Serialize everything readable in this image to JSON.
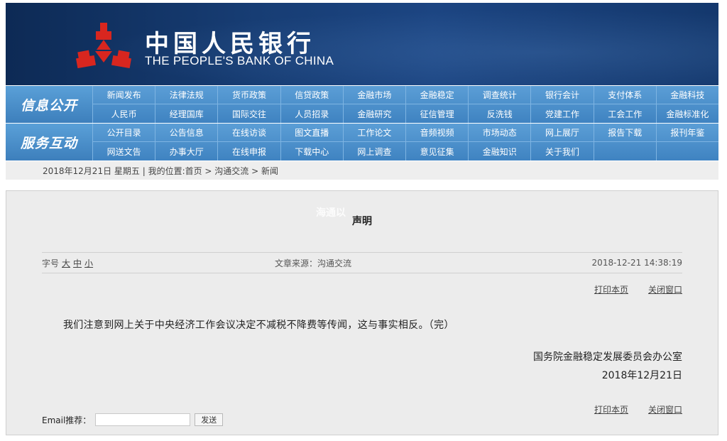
{
  "header": {
    "name_cn": "中国人民银行",
    "name_en": "THE PEOPLE'S BANK OF CHINA",
    "emblem_color": "#d8261f"
  },
  "nav": {
    "group1": {
      "label": "信息公开",
      "row1": [
        "新闻发布",
        "法律法规",
        "货币政策",
        "信贷政策",
        "金融市场",
        "金融稳定",
        "调查统计",
        "银行会计",
        "支付体系",
        "金融科技"
      ],
      "row2": [
        "人民币",
        "经理国库",
        "国际交往",
        "人员招录",
        "金融研究",
        "征信管理",
        "反洗钱",
        "党建工作",
        "工会工作",
        "金融标准化"
      ]
    },
    "group2": {
      "label": "服务互动",
      "row1": [
        "公开目录",
        "公告信息",
        "在线访谈",
        "图文直播",
        "工作论文",
        "音频视频",
        "市场动态",
        "网上展厅",
        "报告下载",
        "报刊年鉴"
      ],
      "row2": [
        "网送文告",
        "办事大厅",
        "在线申报",
        "下载中心",
        "网上调查",
        "意见征集",
        "金融知识",
        "关于我们"
      ]
    }
  },
  "breadcrumb": "2018年12月21日  星期五 | 我的位置:首页 > 沟通交流 > 新闻",
  "article": {
    "title": "声明",
    "watermark": "海通以",
    "font_label": "字号",
    "font_sizes": [
      "大",
      "中",
      "小"
    ],
    "source": "文章来源：沟通交流",
    "datetime": "2018-12-21 14:38:19",
    "print_label": "打印本页",
    "close_label": "关闭窗口",
    "body": "我们注意到网上关于中央经济工作会议决定不减税不降费等传闻，这与事实相反。（完）",
    "signature_org": "国务院金融稳定发展委员会办公室",
    "signature_date": "2018年12月21日"
  },
  "email": {
    "label": "Email推荐：",
    "value": "",
    "button": "发送"
  }
}
